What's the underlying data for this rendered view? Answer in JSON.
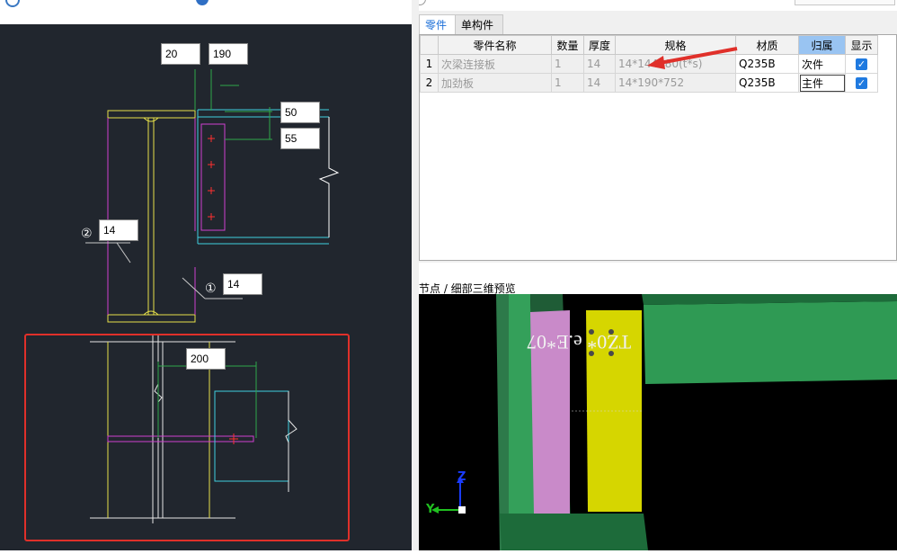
{
  "cad": {
    "dims": {
      "d20": "20",
      "d190": "190",
      "d50": "50",
      "d55": "55",
      "d14a": "14",
      "d14b": "14",
      "d200": "200"
    },
    "markers": {
      "m1": "①",
      "m2": "②"
    },
    "highlight_color": "#e0302a"
  },
  "tabs": [
    "零件",
    "单构件"
  ],
  "table": {
    "headers": [
      "",
      "零件名称",
      "数量",
      "厚度",
      "规格",
      "材质",
      "归属",
      "显示"
    ],
    "rows": [
      {
        "no": "1",
        "name": "次梁连接板",
        "qty": "1",
        "thk": "14",
        "spec": "14*144880(t*s)",
        "mat": "Q235B",
        "owner": "次件",
        "show": true
      },
      {
        "no": "2",
        "name": "加劲板",
        "qty": "1",
        "thk": "14",
        "spec": "14*190*752",
        "mat": "Q235B",
        "owner": "主件",
        "show": true
      }
    ]
  },
  "preview": {
    "label": "节点 / 细部三维预览",
    "mirrored_text": "TZ0* e.E*07",
    "axis_z": "Z",
    "axis_y": "Y"
  }
}
